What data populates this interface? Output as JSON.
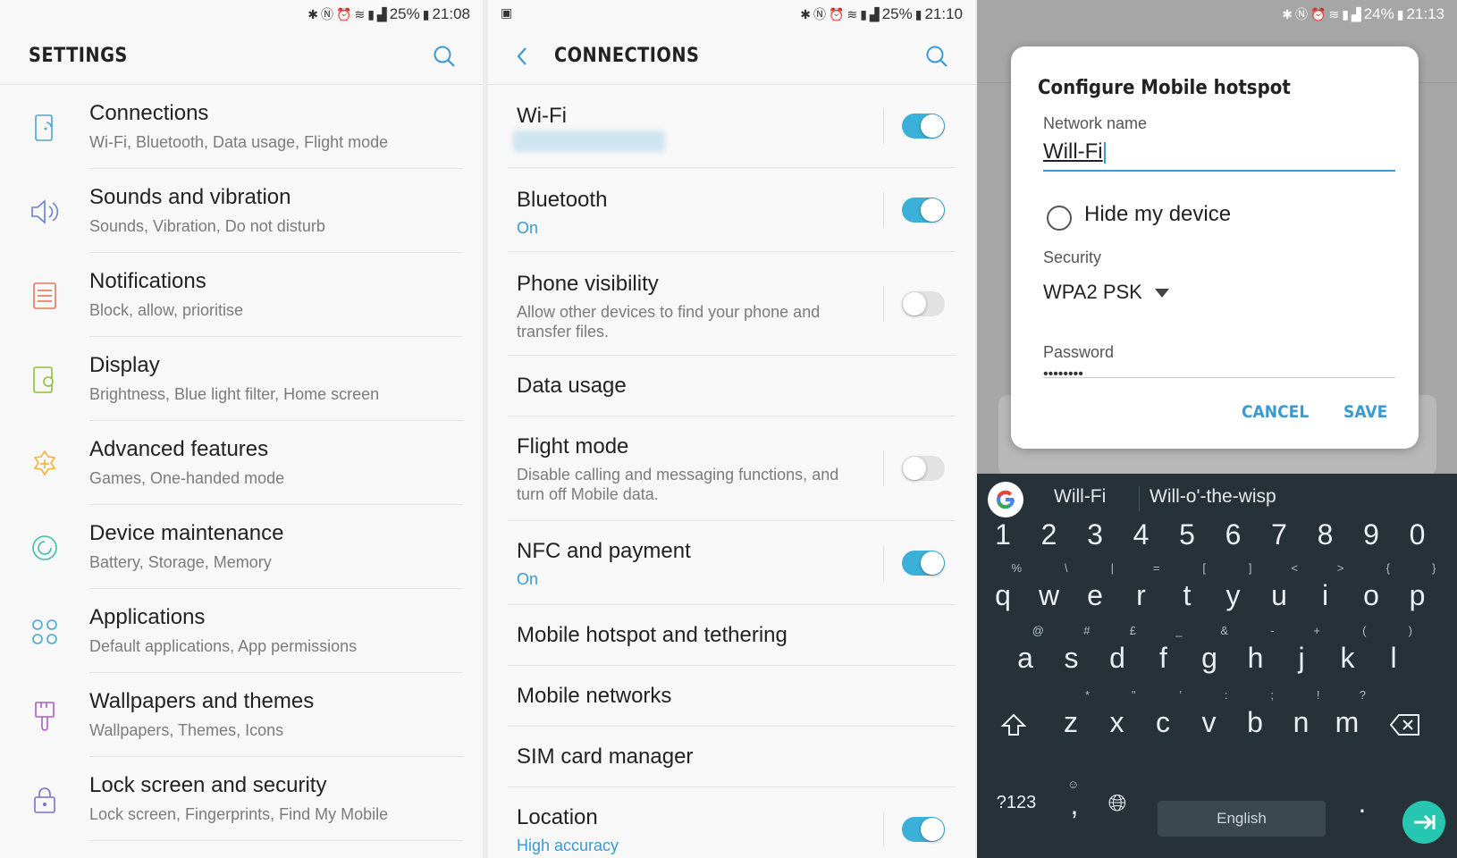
{
  "colors": {
    "accent": "#3a9ad1",
    "toggle_on": "#3bb0d8",
    "keyboard_bg": "#263238",
    "fab": "#26c6b0"
  },
  "panel1": {
    "status": {
      "battery": "25%",
      "time": "21:08"
    },
    "title": "SETTINGS",
    "items": [
      {
        "title": "Connections",
        "subtitle": "Wi-Fi, Bluetooth, Data usage, Flight mode",
        "icon": "connections-icon"
      },
      {
        "title": "Sounds and vibration",
        "subtitle": "Sounds, Vibration, Do not disturb",
        "icon": "speaker-icon"
      },
      {
        "title": "Notifications",
        "subtitle": "Block, allow, prioritise",
        "icon": "notifications-icon"
      },
      {
        "title": "Display",
        "subtitle": "Brightness, Blue light filter, Home screen",
        "icon": "display-icon"
      },
      {
        "title": "Advanced features",
        "subtitle": "Games, One-handed mode",
        "icon": "advanced-features-icon"
      },
      {
        "title": "Device maintenance",
        "subtitle": "Battery, Storage, Memory",
        "icon": "device-maintenance-icon"
      },
      {
        "title": "Applications",
        "subtitle": "Default applications, App permissions",
        "icon": "applications-icon"
      },
      {
        "title": "Wallpapers and themes",
        "subtitle": "Wallpapers, Themes, Icons",
        "icon": "brush-icon"
      },
      {
        "title": "Lock screen and security",
        "subtitle": "Lock screen, Fingerprints, Find My Mobile",
        "icon": "lock-icon"
      }
    ]
  },
  "panel2": {
    "status": {
      "battery": "25%",
      "time": "21:10"
    },
    "title": "CONNECTIONS",
    "items": [
      {
        "title": "Wi-Fi",
        "subtitle": "",
        "toggle": true
      },
      {
        "title": "Bluetooth",
        "subtitle": "On",
        "toggle": true
      },
      {
        "title": "Phone visibility",
        "subtitle": "Allow other devices to find your phone and transfer files.",
        "toggle": false
      },
      {
        "title": "Data usage"
      },
      {
        "title": "Flight mode",
        "subtitle": "Disable calling and messaging functions, and turn off Mobile data.",
        "toggle": false
      },
      {
        "title": "NFC and payment",
        "subtitle": "On",
        "toggle": true
      },
      {
        "title": "Mobile hotspot and tethering"
      },
      {
        "title": "Mobile networks"
      },
      {
        "title": "SIM card manager"
      },
      {
        "title": "Location",
        "subtitle": "High accuracy",
        "toggle": true
      }
    ]
  },
  "panel3": {
    "status": {
      "battery": "24%",
      "time": "21:13"
    },
    "dialog": {
      "title": "Configure Mobile hotspot",
      "network_label": "Network name",
      "network_value": "Will-Fi",
      "hide_label": "Hide my device",
      "security_label": "Security",
      "security_value": "WPA2 PSK",
      "password_label": "Password",
      "password_value": "••••••••",
      "cancel": "CANCEL",
      "save": "SAVE"
    },
    "keyboard": {
      "suggestions": [
        "Will-Fi",
        "Will-o'-the-wisp"
      ],
      "numbers": [
        "1",
        "2",
        "3",
        "4",
        "5",
        "6",
        "7",
        "8",
        "9",
        "0"
      ],
      "row1": [
        "q",
        "w",
        "e",
        "r",
        "t",
        "y",
        "u",
        "i",
        "o",
        "p"
      ],
      "row1_alt": [
        "%",
        "\\",
        "|",
        "=",
        "[",
        "]",
        "<",
        ">",
        "{",
        "}"
      ],
      "row2": [
        "a",
        "s",
        "d",
        "f",
        "g",
        "h",
        "j",
        "k",
        "l"
      ],
      "row2_alt": [
        "@",
        "#",
        "£",
        "_",
        "&",
        "-",
        "+",
        "(",
        ")"
      ],
      "row3": [
        "z",
        "x",
        "c",
        "v",
        "b",
        "n",
        "m"
      ],
      "row3_alt": [
        "*",
        "\"",
        "'",
        ":",
        ";",
        "!",
        "?"
      ],
      "symbols_key": "?123",
      "comma": ",",
      "period": ".",
      "space_label": "English"
    }
  }
}
